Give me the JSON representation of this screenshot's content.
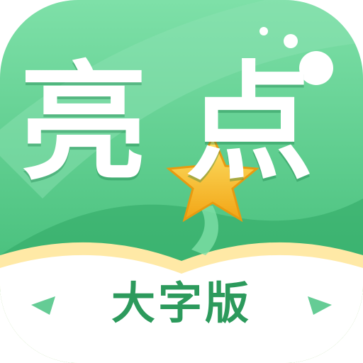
{
  "app_icon": {
    "title_chars": [
      "亮",
      "点"
    ],
    "subtitle": "大字版",
    "icon_names": [
      "star-icon",
      "book-page-icon"
    ],
    "colors": {
      "background": "#3fbf7a",
      "background_light": "#8ee3b3",
      "title": "#ffffff",
      "star": "#f7b51e",
      "subtitle": "#2c9a5c",
      "page": "#ffffff",
      "page_edge": "#ffe9a6"
    }
  }
}
